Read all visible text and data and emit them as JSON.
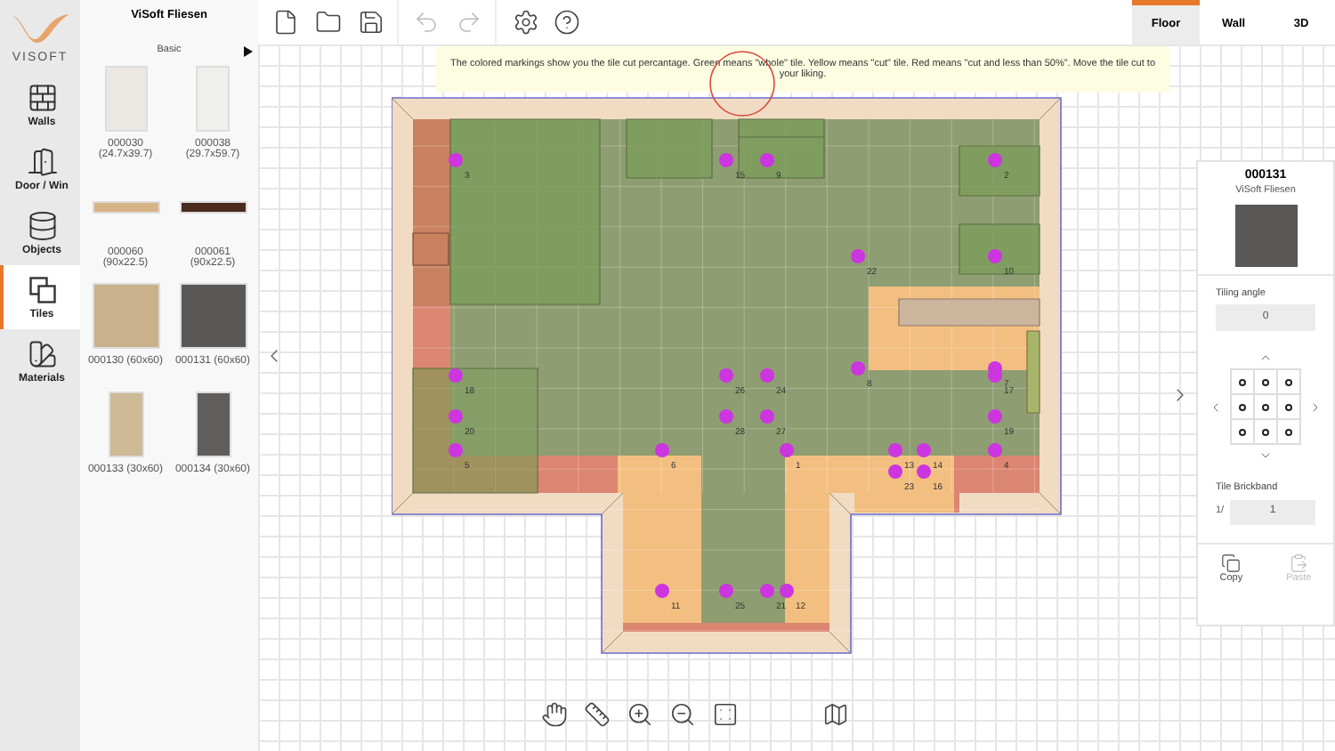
{
  "logo": {
    "text": "VISOFT"
  },
  "nav": [
    {
      "label": "Walls",
      "kind": "walls",
      "selected": false
    },
    {
      "label": "Door / Win",
      "kind": "door",
      "selected": false
    },
    {
      "label": "Objects",
      "kind": "objects",
      "selected": false
    },
    {
      "label": "Tiles",
      "kind": "tiles",
      "selected": true
    },
    {
      "label": "Materials",
      "kind": "materials",
      "selected": false
    }
  ],
  "catalog": {
    "title": "ViSoft Fliesen",
    "category": "Basic"
  },
  "tiles": [
    {
      "label": "000030 (24.7x39.7)",
      "kind": "portrait",
      "color": "#ebe8e4"
    },
    {
      "label": "000038 (29.7x59.7)",
      "kind": "slim",
      "color": "#efefec"
    },
    {
      "label": "000060 (90x22.5)",
      "kind": "strip",
      "color": "#d8b386"
    },
    {
      "label": "000061 (90x22.5)",
      "kind": "strip",
      "color": "#4a2b1e"
    },
    {
      "label": "000130 (60x60)",
      "kind": "square",
      "color": "#c9b18c"
    },
    {
      "label": "000131 (60x60)",
      "kind": "square",
      "color": "#5a5856"
    },
    {
      "label": "000133 (30x60)",
      "kind": "narrow",
      "color": "#cdb995"
    },
    {
      "label": "000134 (30x60)",
      "kind": "narrow",
      "color": "#5f5e5c"
    }
  ],
  "view_tabs": [
    {
      "label": "Floor",
      "selected": true
    },
    {
      "label": "Wall",
      "selected": false
    },
    {
      "label": "3D",
      "selected": false
    }
  ],
  "hint": "The colored markings show you the tile cut percantage. Green means \"whole\" tile. Yellow means \"cut\" tile. Red means \"cut and less than 50%\". Move the tile cut to your liking.",
  "markers": [
    {
      "label": "3"
    },
    {
      "label": "15"
    },
    {
      "label": "9"
    },
    {
      "label": "2"
    },
    {
      "label": "22"
    },
    {
      "label": "10"
    },
    {
      "label": "18"
    },
    {
      "label": "26"
    },
    {
      "label": "24"
    },
    {
      "label": "8"
    },
    {
      "label": "7"
    },
    {
      "label": "17"
    },
    {
      "label": "20"
    },
    {
      "label": "28"
    },
    {
      "label": "27"
    },
    {
      "label": "19"
    },
    {
      "label": "5"
    },
    {
      "label": "6"
    },
    {
      "label": "1"
    },
    {
      "label": "13"
    },
    {
      "label": "14"
    },
    {
      "label": "23"
    },
    {
      "label": "16"
    },
    {
      "label": "4"
    },
    {
      "label": "11"
    },
    {
      "label": "25"
    },
    {
      "label": "21"
    },
    {
      "label": "12"
    }
  ],
  "properties": {
    "code": "000131",
    "brand": "ViSoft Fliesen",
    "tiling_angle_label": "Tiling angle",
    "tiling_angle": "0",
    "brickband_label": "Tile Brickband",
    "brickband_prefix": "1/",
    "brickband": "1",
    "actions": [
      {
        "label": "Copy",
        "kind": "copy",
        "disabled": false
      },
      {
        "label": "Paste",
        "kind": "paste",
        "disabled": true
      }
    ]
  }
}
